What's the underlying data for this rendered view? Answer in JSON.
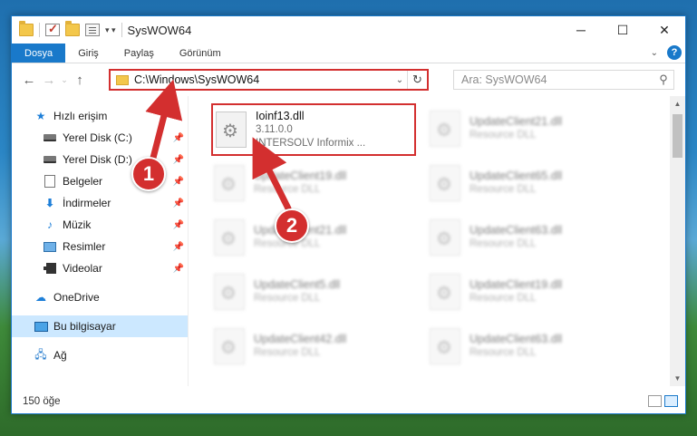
{
  "window": {
    "title": "SysWOW64"
  },
  "ribbon": {
    "tabs": [
      "Dosya",
      "Giriş",
      "Paylaş",
      "Görünüm"
    ]
  },
  "address": {
    "path": "C:\\Windows\\SysWOW64"
  },
  "search": {
    "placeholder": "Ara: SysWOW64"
  },
  "sidebar": {
    "quick_access": "Hızlı erişim",
    "items": [
      {
        "label": "Yerel Disk (C:)",
        "icon": "disk-icon"
      },
      {
        "label": "Yerel Disk (D:)",
        "icon": "disk-icon"
      },
      {
        "label": "Belgeler",
        "icon": "documents-icon"
      },
      {
        "label": "İndirmeler",
        "icon": "download-icon"
      },
      {
        "label": "Müzik",
        "icon": "music-icon"
      },
      {
        "label": "Resimler",
        "icon": "pictures-icon"
      },
      {
        "label": "Videolar",
        "icon": "video-icon"
      }
    ],
    "onedrive": "OneDrive",
    "this_pc": "Bu bilgisayar",
    "network": "Ağ"
  },
  "files": {
    "highlighted": {
      "name": "Ioinf13.dll",
      "version": "3.11.0.0",
      "desc": "INTERSOLV Informix ..."
    },
    "col1": [
      {
        "name": "UpdateClient19.dll",
        "desc": "Resource DLL"
      },
      {
        "name": "UpdateClient21.dll",
        "desc": "Resource DLL"
      },
      {
        "name": "UpdateClient5.dll",
        "desc": "Resource DLL"
      },
      {
        "name": "UpdateClient42.dll",
        "desc": "Resource DLL"
      }
    ],
    "col2": [
      {
        "name": "UpdateClient21.dll",
        "desc": "Resource DLL"
      },
      {
        "name": "UpdateClient65.dll",
        "desc": "Resource DLL"
      },
      {
        "name": "UpdateClient63.dll",
        "desc": "Resource DLL"
      },
      {
        "name": "UpdateClient19.dll",
        "desc": "Resource DLL"
      },
      {
        "name": "UpdateClient63.dll",
        "desc": "Resource DLL"
      }
    ]
  },
  "status": {
    "count": "150 öğe"
  },
  "annotations": {
    "step1": "1",
    "step2": "2",
    "color": "#d32f2f"
  }
}
